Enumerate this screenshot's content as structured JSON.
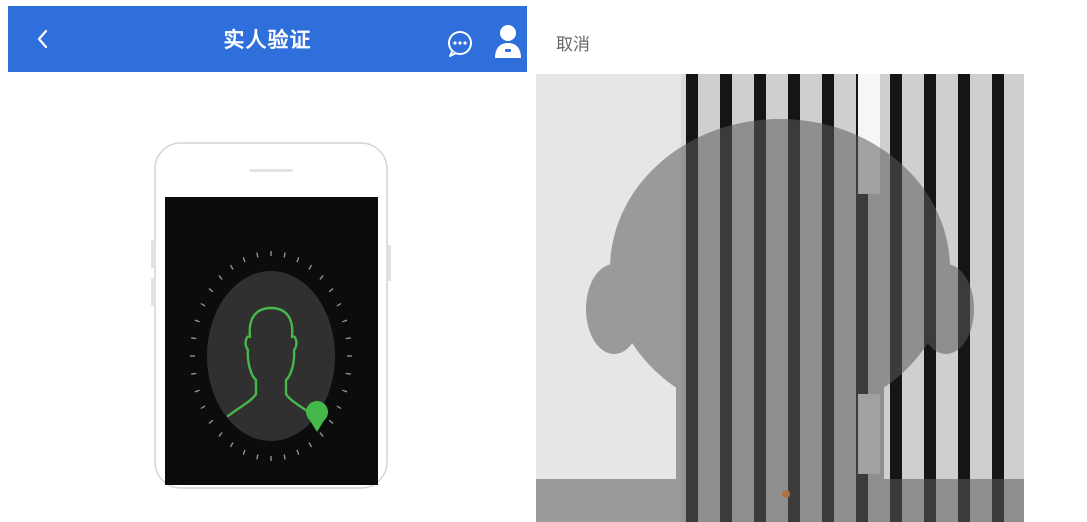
{
  "header": {
    "title": "实人验证",
    "back_icon": "chevron-left-icon",
    "chat_icon": "chat-bubble-icon",
    "user_icon": "user-icon",
    "bar_color": "#2f6fdc"
  },
  "camera": {
    "cancel_label": "取消"
  },
  "colors": {
    "face_outline": "#45b84a",
    "phone_screen": "#0c0c0c"
  }
}
